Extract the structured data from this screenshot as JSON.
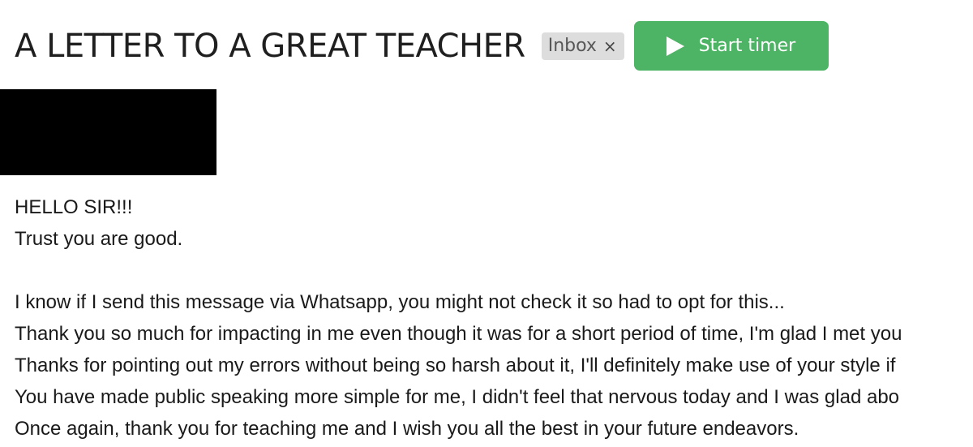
{
  "email": {
    "subject": "A LETTER TO A GREAT TEACHER",
    "label": "Inbox",
    "label_remove": "×",
    "timer_button": "Start timer",
    "icons": {
      "timer": "play-icon",
      "label_remove": "close-icon"
    },
    "colors": {
      "timer_button": "#4cb464",
      "label_chip": "#dddddd",
      "redaction": "#000000"
    },
    "body": {
      "greeting": "HELLO SIR!!!",
      "opening": "Trust you are good.",
      "lines": [
        "I know if I send this message via Whatsapp, you might not check it so had to opt for this...",
        "Thank you so much for impacting in me even though it was for a short period of time, I'm glad I met you",
        "Thanks for pointing out my errors without being so harsh about it, I'll definitely make use of your style if",
        "You have made public speaking more simple for me, I didn't feel that nervous today and I was glad abo",
        "Once again, thank you for teaching me and I wish you all the best in your future endeavors."
      ]
    }
  }
}
